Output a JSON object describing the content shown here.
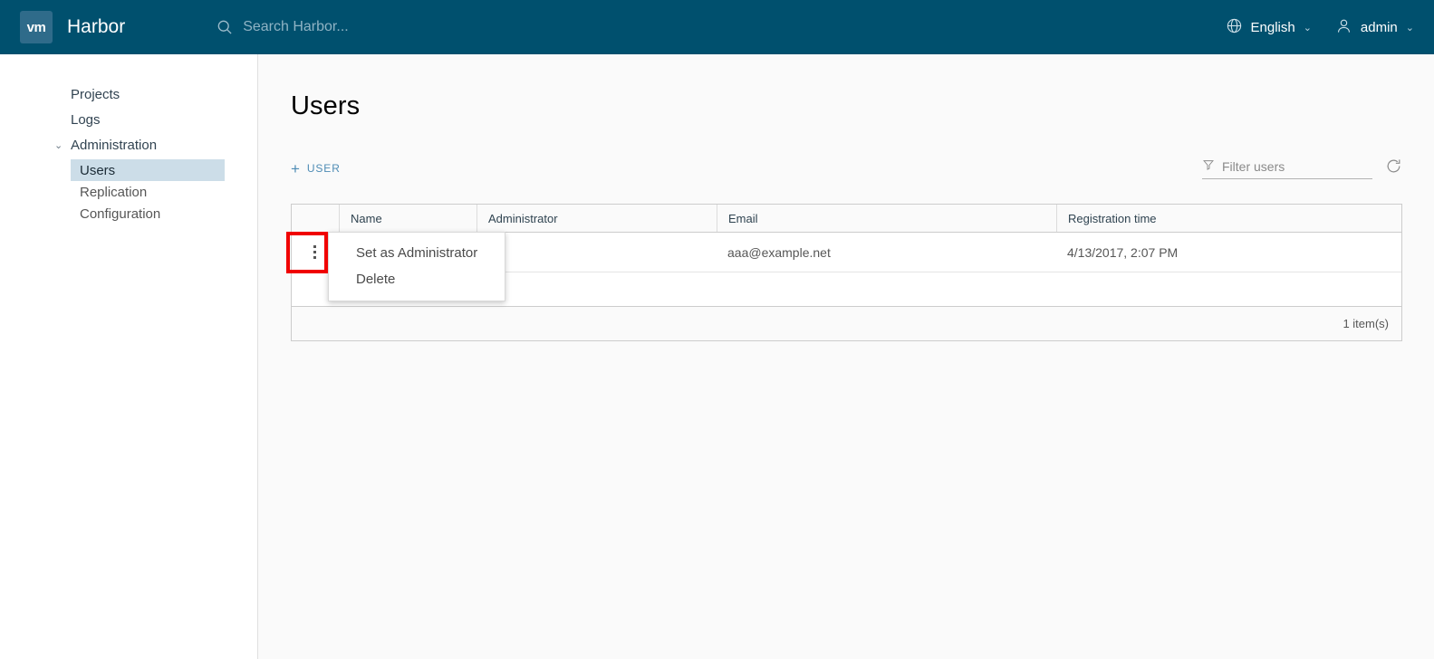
{
  "header": {
    "logo_text": "vm",
    "brand_title": "Harbor",
    "search_placeholder": "Search Harbor...",
    "search_value": "",
    "search_icon": "search-icon",
    "language": "English",
    "language_icon": "globe-icon",
    "user": "admin",
    "user_icon": "user-icon",
    "caret": "⌄",
    "background_color": "#00506e",
    "logo_tile_color": "#2f6b8a"
  },
  "sidebar": {
    "items": [
      {
        "label": "Projects",
        "type": "link",
        "active": false
      },
      {
        "label": "Logs",
        "type": "link",
        "active": false
      },
      {
        "label": "Administration",
        "type": "group",
        "active": false,
        "caret": "⌄"
      },
      {
        "label": "Users",
        "type": "sub",
        "active": true
      },
      {
        "label": "Replication",
        "type": "sub",
        "active": false
      },
      {
        "label": "Configuration",
        "type": "sub",
        "active": false
      }
    ],
    "active_background": "#ccdde8"
  },
  "main": {
    "page_title": "Users",
    "add_button": {
      "label": "USER",
      "icon": "plus-icon",
      "color": "#4e8cb5"
    },
    "filter": {
      "placeholder": "Filter users",
      "value": "",
      "icon": "filter-icon"
    },
    "refresh_icon": "refresh-icon"
  },
  "table": {
    "columns": [
      {
        "key": "actions",
        "label": ""
      },
      {
        "key": "name",
        "label": "Name"
      },
      {
        "key": "administrator",
        "label": "Administrator"
      },
      {
        "key": "email",
        "label": "Email"
      },
      {
        "key": "registration_time",
        "label": "Registration time"
      }
    ],
    "rows": [
      {
        "kebab_icon": "kebab-menu-icon",
        "name": "",
        "administrator": "",
        "email": "aaa@example.net",
        "registration_time": "4/13/2017, 2:07 PM"
      }
    ],
    "footer_text": "1 item(s)"
  },
  "context_menu": {
    "visible": true,
    "items": [
      {
        "label": "Set as Administrator"
      },
      {
        "label": "Delete"
      }
    ]
  },
  "annotation": {
    "highlight_color": "#f00000",
    "target": "kebab-menu-icon"
  }
}
